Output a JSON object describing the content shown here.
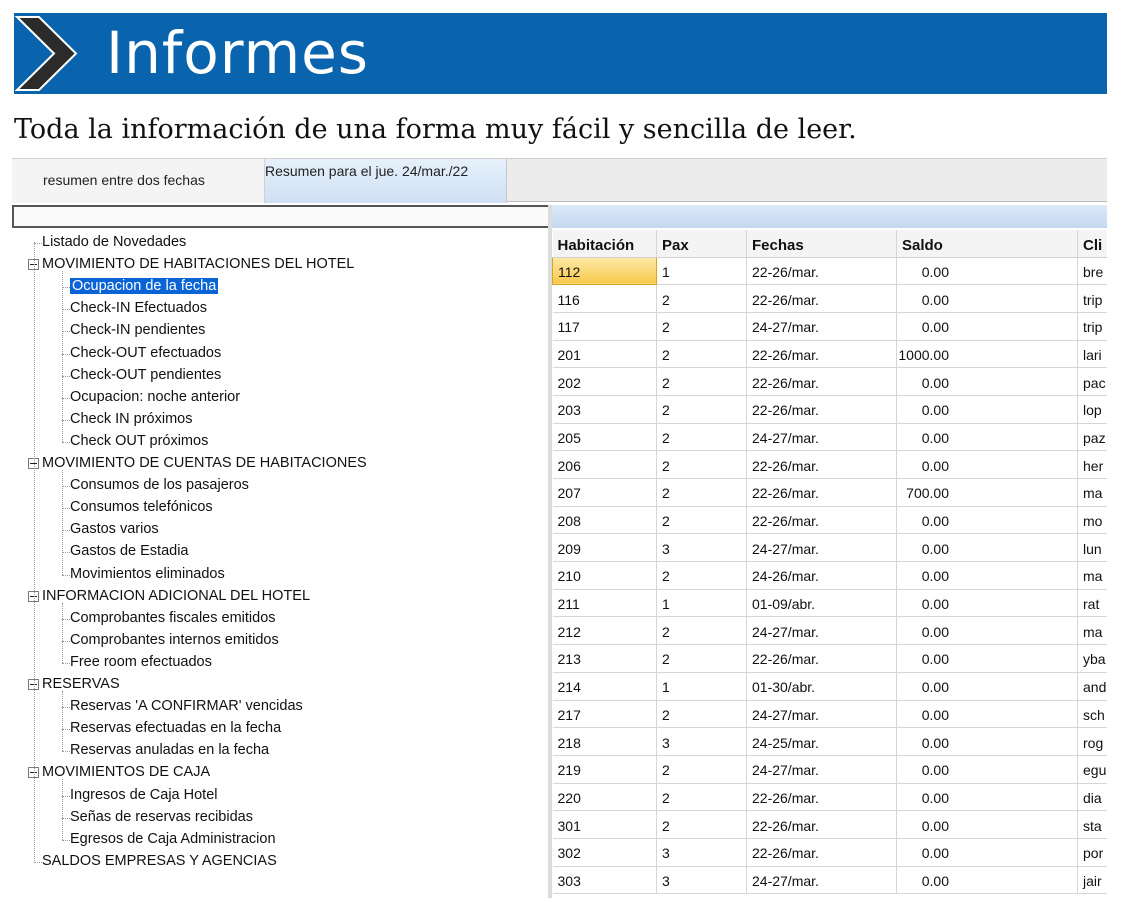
{
  "banner": {
    "title": "Informes"
  },
  "subtitle": "Toda la información de una forma muy fácil y sencilla de leer.",
  "tabs": [
    {
      "label": "resumen entre dos fechas"
    },
    {
      "label": "Resumen para el jue. 24/mar./22"
    }
  ],
  "tree": {
    "items": [
      {
        "label": "Listado de Novedades",
        "level": 0
      },
      {
        "label": "MOVIMIENTO DE HABITACIONES DEL HOTEL",
        "level": 0,
        "expanded": true
      },
      {
        "label": "Ocupacion de la fecha",
        "level": 1,
        "selected": true
      },
      {
        "label": "Check-IN Efectuados",
        "level": 1
      },
      {
        "label": "Check-IN pendientes",
        "level": 1
      },
      {
        "label": "Check-OUT efectuados",
        "level": 1
      },
      {
        "label": "Check-OUT pendientes",
        "level": 1
      },
      {
        "label": "Ocupacion: noche anterior",
        "level": 1
      },
      {
        "label": "Check IN próximos",
        "level": 1
      },
      {
        "label": "Check OUT próximos",
        "level": 1
      },
      {
        "label": "MOVIMIENTO DE CUENTAS DE HABITACIONES",
        "level": 0,
        "expanded": true
      },
      {
        "label": "Consumos de los pasajeros",
        "level": 1
      },
      {
        "label": "Consumos telefónicos",
        "level": 1
      },
      {
        "label": "Gastos varios",
        "level": 1
      },
      {
        "label": "Gastos de Estadia",
        "level": 1
      },
      {
        "label": "Movimientos eliminados",
        "level": 1
      },
      {
        "label": "INFORMACION ADICIONAL DEL HOTEL",
        "level": 0,
        "expanded": true
      },
      {
        "label": "Comprobantes fiscales emitidos",
        "level": 1
      },
      {
        "label": "Comprobantes internos emitidos",
        "level": 1
      },
      {
        "label": "Free room efectuados",
        "level": 1
      },
      {
        "label": "RESERVAS",
        "level": 0,
        "expanded": true
      },
      {
        "label": "Reservas 'A CONFIRMAR' vencidas",
        "level": 1
      },
      {
        "label": "Reservas efectuadas en la fecha",
        "level": 1
      },
      {
        "label": "Reservas anuladas en la fecha",
        "level": 1
      },
      {
        "label": "MOVIMIENTOS DE CAJA",
        "level": 0,
        "expanded": true
      },
      {
        "label": "Ingresos de Caja Hotel",
        "level": 1
      },
      {
        "label": "Señas de reservas recibidas",
        "level": 1
      },
      {
        "label": "Egresos de Caja Administracion",
        "level": 1
      },
      {
        "label": "SALDOS EMPRESAS Y AGENCIAS",
        "level": 0
      }
    ]
  },
  "table": {
    "headers": [
      "Habitación",
      "Pax",
      "Fechas",
      "Saldo",
      "Cli"
    ],
    "rows": [
      [
        "112",
        "1",
        "22-26/mar.",
        "0.00",
        "bre"
      ],
      [
        "116",
        "2",
        "22-26/mar.",
        "0.00",
        "trip"
      ],
      [
        "117",
        "2",
        "24-27/mar.",
        "0.00",
        "trip"
      ],
      [
        "201",
        "2",
        "22-26/mar.",
        "1000.00",
        "lari"
      ],
      [
        "202",
        "2",
        "22-26/mar.",
        "0.00",
        "pac"
      ],
      [
        "203",
        "2",
        "22-26/mar.",
        "0.00",
        "lop"
      ],
      [
        "205",
        "2",
        "24-27/mar.",
        "0.00",
        "paz"
      ],
      [
        "206",
        "2",
        "22-26/mar.",
        "0.00",
        "her"
      ],
      [
        "207",
        "2",
        "22-26/mar.",
        "700.00",
        "ma"
      ],
      [
        "208",
        "2",
        "22-26/mar.",
        "0.00",
        "mo"
      ],
      [
        "209",
        "3",
        "24-27/mar.",
        "0.00",
        "lun"
      ],
      [
        "210",
        "2",
        "24-26/mar.",
        "0.00",
        "ma"
      ],
      [
        "211",
        "1",
        "01-09/abr.",
        "0.00",
        "rat"
      ],
      [
        "212",
        "2",
        "24-27/mar.",
        "0.00",
        "ma"
      ],
      [
        "213",
        "2",
        "22-26/mar.",
        "0.00",
        "yba"
      ],
      [
        "214",
        "1",
        "01-30/abr.",
        "0.00",
        "and"
      ],
      [
        "217",
        "2",
        "24-27/mar.",
        "0.00",
        "sch"
      ],
      [
        "218",
        "3",
        "24-25/mar.",
        "0.00",
        "rog"
      ],
      [
        "219",
        "2",
        "24-27/mar.",
        "0.00",
        "egu"
      ],
      [
        "220",
        "2",
        "22-26/mar.",
        "0.00",
        "dia"
      ],
      [
        "301",
        "2",
        "22-26/mar.",
        "0.00",
        "sta"
      ],
      [
        "302",
        "3",
        "22-26/mar.",
        "0.00",
        "por"
      ],
      [
        "303",
        "3",
        "24-27/mar.",
        "0.00",
        "jair"
      ]
    ]
  }
}
